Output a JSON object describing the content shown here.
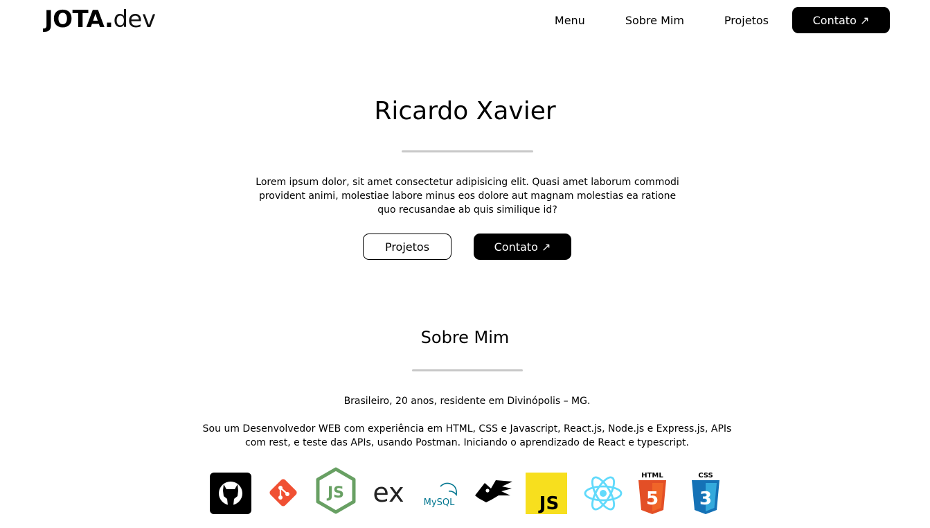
{
  "header": {
    "logo_bold": "JOTA.",
    "logo_light": "dev",
    "nav": [
      {
        "label": "Menu"
      },
      {
        "label": "Sobre Mim"
      },
      {
        "label": "Projetos"
      }
    ],
    "cta_label": "Contato ↗"
  },
  "hero": {
    "name": "Ricardo Xavier",
    "text": "Lorem ipsum dolor, sit amet consectetur adipisicing elit. Quasi amet laborum commodi provident animi, molestiae labore minus eos dolore aut magnam molestias ea ratione quo recusandae ab quis similique id?",
    "btn_projects": "Projetos",
    "btn_contact": "Contato ↗"
  },
  "about": {
    "title": "Sobre Mim",
    "line1": "Brasileiro, 20 anos, residente em Divinópolis – MG.",
    "line2": "Sou um Desenvolvedor WEB com experiência em HTML, CSS e Javascript, React.js, Node.js e Express.js, APIs com rest, e teste das APIs, usando Postman. Iniciando o aprendizado de React e typescript."
  },
  "tech": {
    "express_text": "ex",
    "mysql_text": "MySQL",
    "js_text": "JS",
    "html_text": "HTML",
    "css_text": "CSS",
    "html_shield": "5",
    "css_shield": "3",
    "icons": [
      "github-icon",
      "git-icon",
      "nodejs-icon",
      "express-icon",
      "mysql-icon",
      "postman-icon",
      "javascript-icon",
      "react-icon",
      "html5-icon",
      "css3-icon"
    ]
  },
  "colors": {
    "text": "#000000",
    "button_bg": "#000000",
    "divider": "#c8c8c8",
    "git": "#f05033",
    "node": "#68a063",
    "js": "#f7df1e",
    "react": "#61dafb",
    "html": "#e34f26",
    "css": "#1572b6",
    "mysql": "#00758f"
  }
}
